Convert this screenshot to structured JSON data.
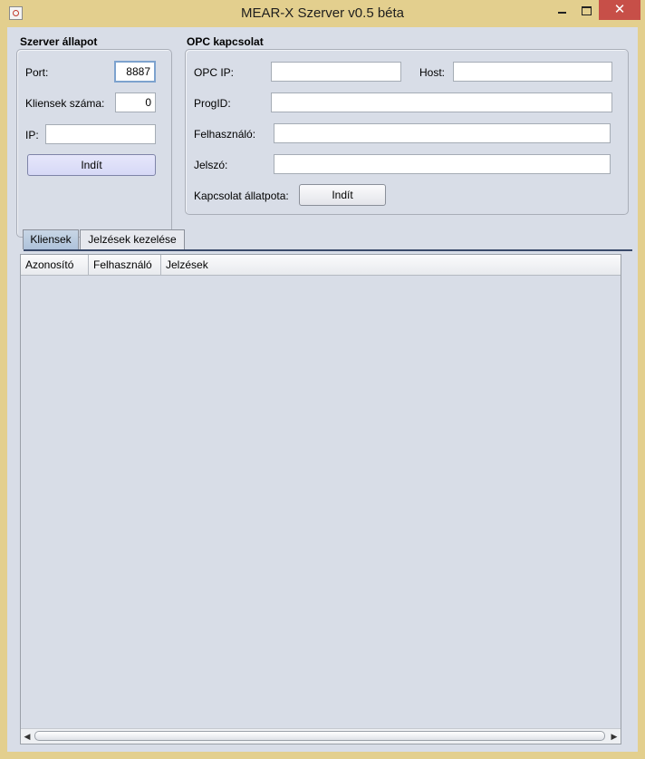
{
  "window": {
    "title": "MEAR-X Szerver v0.5 béta",
    "close_glyph": "✕",
    "accent_color": "#e3cf8e",
    "close_color": "#c74f48"
  },
  "server_status": {
    "title": "Szerver állapot",
    "port_label": "Port:",
    "port_value": "8887",
    "clients_label": "Kliensek száma:",
    "clients_value": "0",
    "ip_label": "IP:",
    "ip_value": "",
    "start_label": "Indít"
  },
  "opc": {
    "title": "OPC kapcsolat",
    "opc_ip_label": "OPC IP:",
    "opc_ip_value": "",
    "host_label": "Host:",
    "host_value": "",
    "progid_label": "ProgID:",
    "progid_value": "",
    "user_label": "Felhasználó:",
    "user_value": "",
    "password_label": "Jelszó:",
    "password_value": "",
    "conn_state_label": "Kapcsolat állatpota:",
    "start_label": "Indít"
  },
  "tabs": [
    {
      "label": "Kliensek",
      "active": true
    },
    {
      "label": "Jelzések kezelése",
      "active": false
    }
  ],
  "table": {
    "columns": [
      "Azonosító",
      "Felhasználó",
      "Jelzések"
    ],
    "rows": []
  },
  "scrollbar": {
    "left_arrow": "◀",
    "right_arrow": "▶"
  }
}
